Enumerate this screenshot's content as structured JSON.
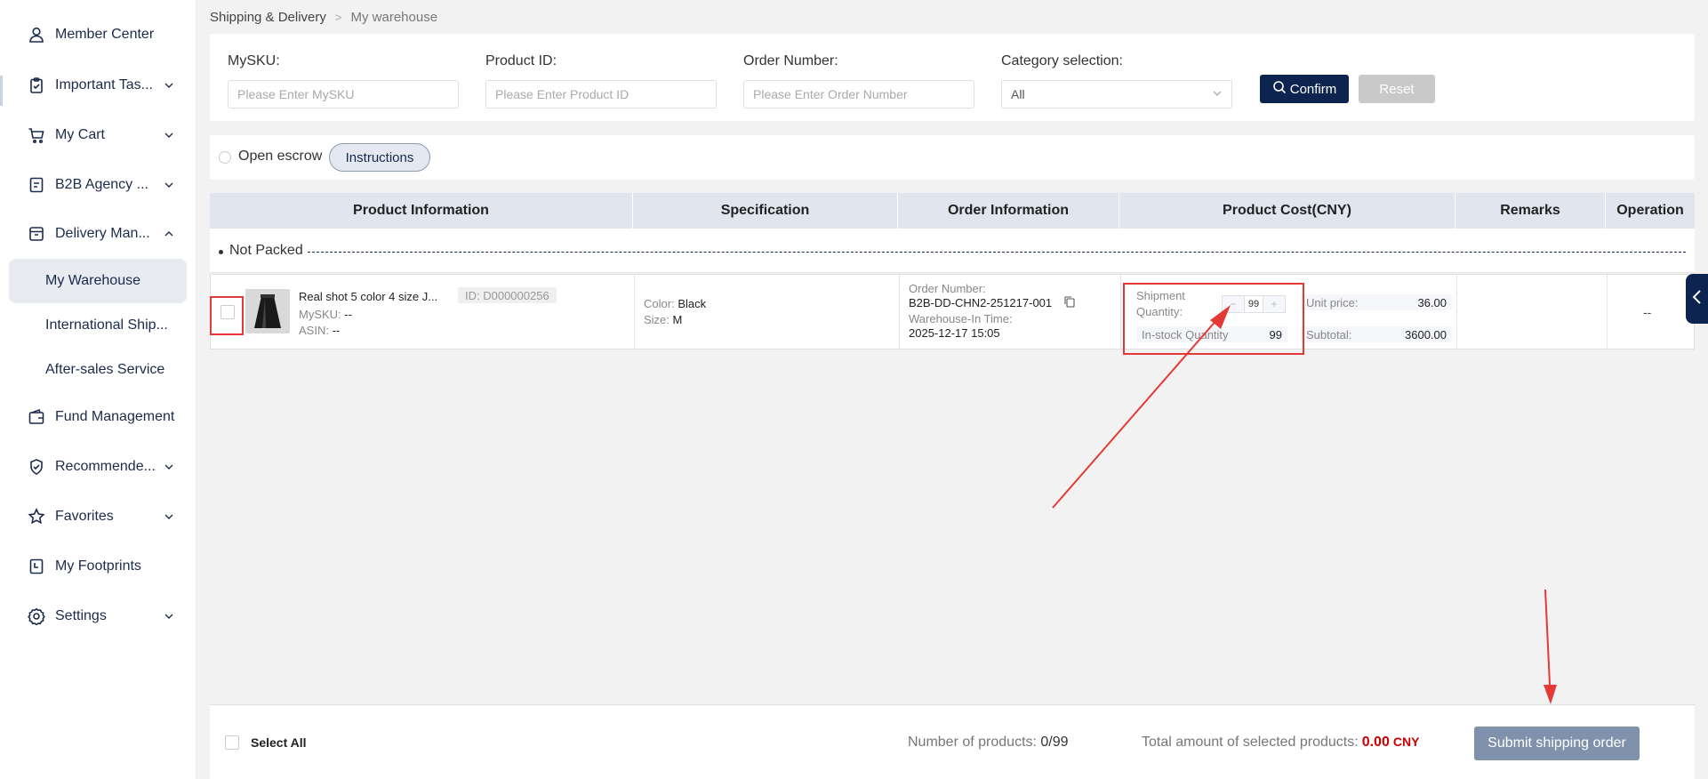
{
  "sidebar": {
    "items": [
      {
        "label": "Member Center",
        "icon": "user-icon"
      },
      {
        "label": "Important Tas...",
        "icon": "clipboard-icon"
      },
      {
        "label": "My Cart",
        "icon": "cart-icon"
      },
      {
        "label": "B2B Agency ...",
        "icon": "document-icon"
      },
      {
        "label": "Delivery Man...",
        "icon": "box-icon"
      },
      {
        "label": "Fund Management",
        "icon": "wallet-icon"
      },
      {
        "label": "Recommende...",
        "icon": "badge-icon"
      },
      {
        "label": "Favorites",
        "icon": "star-icon"
      },
      {
        "label": "My Footprints",
        "icon": "footprint-icon"
      },
      {
        "label": "Settings",
        "icon": "gear-icon"
      }
    ],
    "subitems": [
      {
        "label": "My Warehouse",
        "active": true
      },
      {
        "label": "International Ship...",
        "active": false
      },
      {
        "label": "After-sales Service",
        "active": false
      }
    ]
  },
  "breadcrumb": {
    "parent": "Shipping & Delivery",
    "separator": ">",
    "current": "My warehouse"
  },
  "filters": {
    "mysku": {
      "label": "MySKU:",
      "placeholder": "Please Enter MySKU"
    },
    "product_id": {
      "label": "Product ID:",
      "placeholder": "Please Enter Product ID"
    },
    "order_number": {
      "label": "Order Number:",
      "placeholder": "Please Enter Order Number"
    },
    "category": {
      "label": "Category selection:",
      "value": "All"
    },
    "confirm_label": "Confirm",
    "reset_label": "Reset"
  },
  "escrow": {
    "label": "Open escrow",
    "instructions_label": "Instructions"
  },
  "table": {
    "columns": [
      "Product Information",
      "Specification",
      "Order Information",
      "Product Cost(CNY)",
      "Remarks",
      "Operation"
    ],
    "group_label": "Not Packed",
    "row": {
      "product_name": "Real shot 5 color 4 size J...",
      "product_id": "ID: D000000256",
      "mysku_label": "MySKU:",
      "mysku_value": "--",
      "asin_label": "ASIN:",
      "asin_value": "--",
      "color_label": "Color:",
      "color_value": "Black",
      "size_label": "Size:",
      "size_value": "M",
      "order_number_label": "Order Number:",
      "order_number": "B2B-DD-CHN2-251217-001",
      "warehouse_in_label": "Warehouse-In Time:",
      "warehouse_in_time": "2025-12-17 15:05",
      "shipment_qty_label_1": "Shipment",
      "shipment_qty_label_2": "Quantity:",
      "shipment_qty_value": "99",
      "instock_qty_label": "In-stock Quantity",
      "instock_qty_value": "99",
      "unit_price_label": "Unit price:",
      "unit_price_value": "36.00",
      "subtotal_label": "Subtotal:",
      "subtotal_value": "3600.00",
      "operation": "--"
    }
  },
  "footer": {
    "select_all_label": "Select All",
    "count_label": "Number of products:",
    "count_value": "0/99",
    "total_label": "Total amount of selected products:",
    "total_value": "0.00",
    "currency": "CNY",
    "submit_label": "Submit shipping order"
  },
  "colors": {
    "primary": "#0d2450",
    "highlight": "#e53935",
    "submit": "#7f91ab",
    "amount": "#cc0000"
  }
}
